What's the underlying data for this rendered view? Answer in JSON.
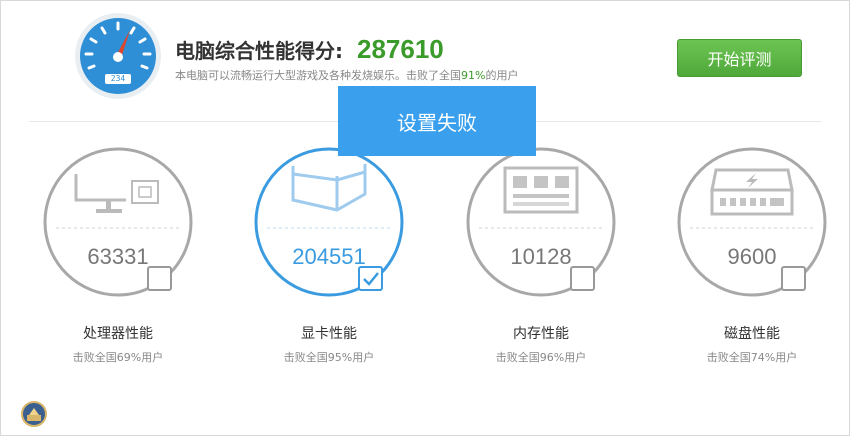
{
  "header": {
    "title": "电脑综合性能得分:",
    "score": "287610",
    "subtitle_prefix": "本电脑可以流畅运行大型游戏及各种发烧娱乐。击败了全国",
    "subtitle_pct": "91%",
    "subtitle_suffix": "的用户",
    "gauge_readout": "234",
    "start_button": "开始评测"
  },
  "toast": "设置失败",
  "cards": [
    {
      "score": "63331",
      "name": "处理器性能",
      "desc": "击败全国69%用户",
      "checked": false,
      "icon": "cpu-monitor-icon"
    },
    {
      "score": "204551",
      "name": "显卡性能",
      "desc": "击败全国95%用户",
      "checked": true,
      "icon": "gpu-cube-icon"
    },
    {
      "score": "10128",
      "name": "内存性能",
      "desc": "击败全国96%用户",
      "checked": false,
      "icon": "memory-chip-icon"
    },
    {
      "score": "9600",
      "name": "磁盘性能",
      "desc": "击败全国74%用户",
      "checked": false,
      "icon": "hard-disk-icon"
    }
  ],
  "colors": {
    "score_green": "#3a9a2a",
    "accent_blue": "#3aa0ed",
    "button_green": "#5cb847",
    "gauge_blue": "#2d8ed8",
    "gauge_needle": "#e0452b"
  }
}
